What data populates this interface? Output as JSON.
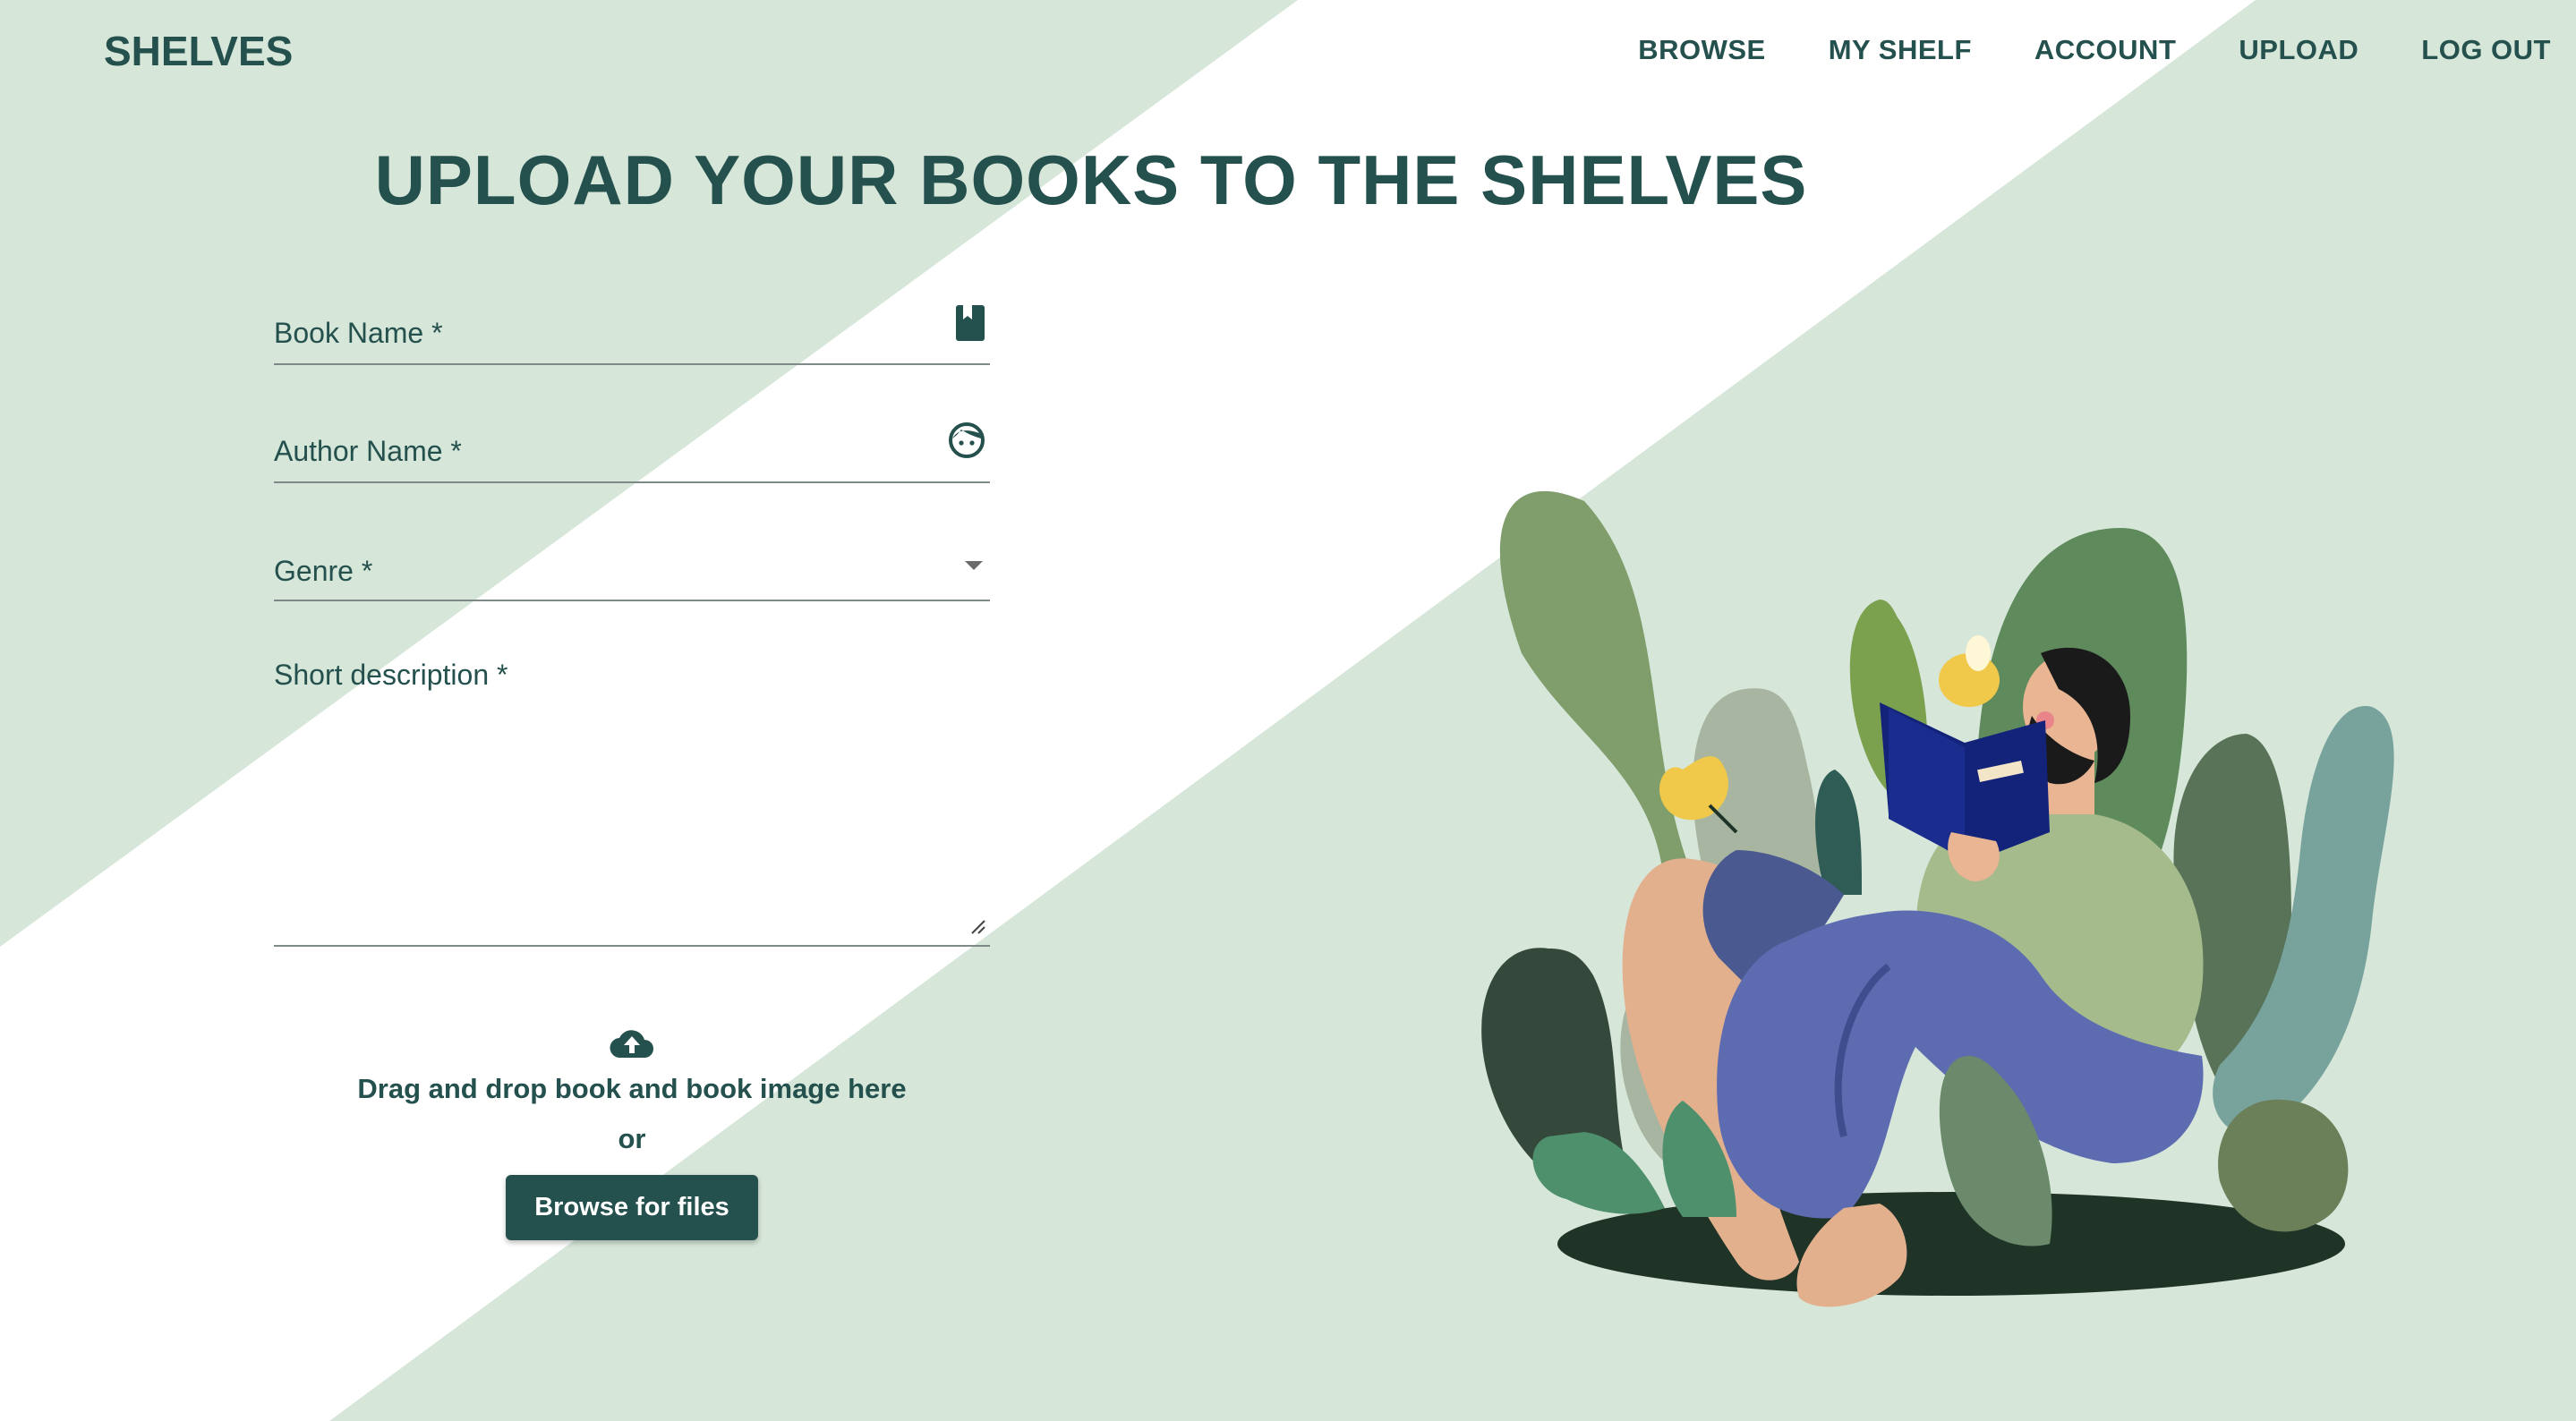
{
  "app": {
    "brand": "SHELVES"
  },
  "nav": {
    "items": [
      "BROWSE",
      "MY SHELF",
      "ACCOUNT",
      "UPLOAD",
      "LOG OUT"
    ]
  },
  "page": {
    "title": "UPLOAD YOUR BOOKS TO THE SHELVES"
  },
  "form": {
    "book_name": {
      "label": "Book Name *",
      "value": "",
      "icon": "book-icon"
    },
    "author_name": {
      "label": "Author Name *",
      "value": "",
      "icon": "face-icon"
    },
    "genre": {
      "label": "Genre *",
      "value": "",
      "icon": "dropdown-arrow-icon"
    },
    "description": {
      "label": "Short description *",
      "value": ""
    }
  },
  "dropzone": {
    "icon": "cloud-upload-icon",
    "text": "Drag and drop book and book image here",
    "or_text": "or",
    "button_label": "Browse for files"
  },
  "colors": {
    "primary": "#24504d",
    "background_band": "#d6e6d9",
    "white": "#ffffff"
  }
}
